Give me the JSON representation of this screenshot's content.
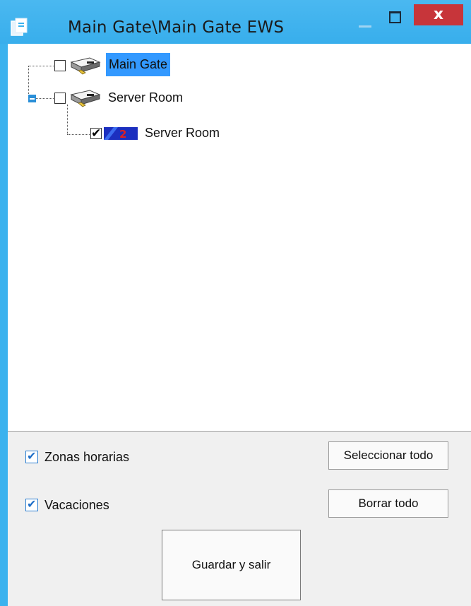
{
  "window": {
    "title": "Main Gate\\Main Gate EWS",
    "close_glyph": "x",
    "accent_color": "#3bb2ee",
    "close_color": "#c7353a"
  },
  "tree": {
    "nodes": [
      {
        "label": "Main Gate",
        "checked": false,
        "selected": true,
        "icon": "door-controller-icon"
      },
      {
        "label": "Server Room",
        "checked": false,
        "selected": false,
        "expanded": true,
        "icon": "door-controller-icon"
      },
      {
        "label": "Server Room",
        "checked": true,
        "selected": false,
        "icon": "reader-icon"
      }
    ]
  },
  "options": {
    "time_zones_label": "Zonas horarias",
    "time_zones_checked": true,
    "holidays_label": "Vacaciones",
    "holidays_checked": true
  },
  "buttons": {
    "select_all": "Seleccionar todo",
    "clear_all": "Borrar todo",
    "save_exit": "Guardar y salir"
  }
}
